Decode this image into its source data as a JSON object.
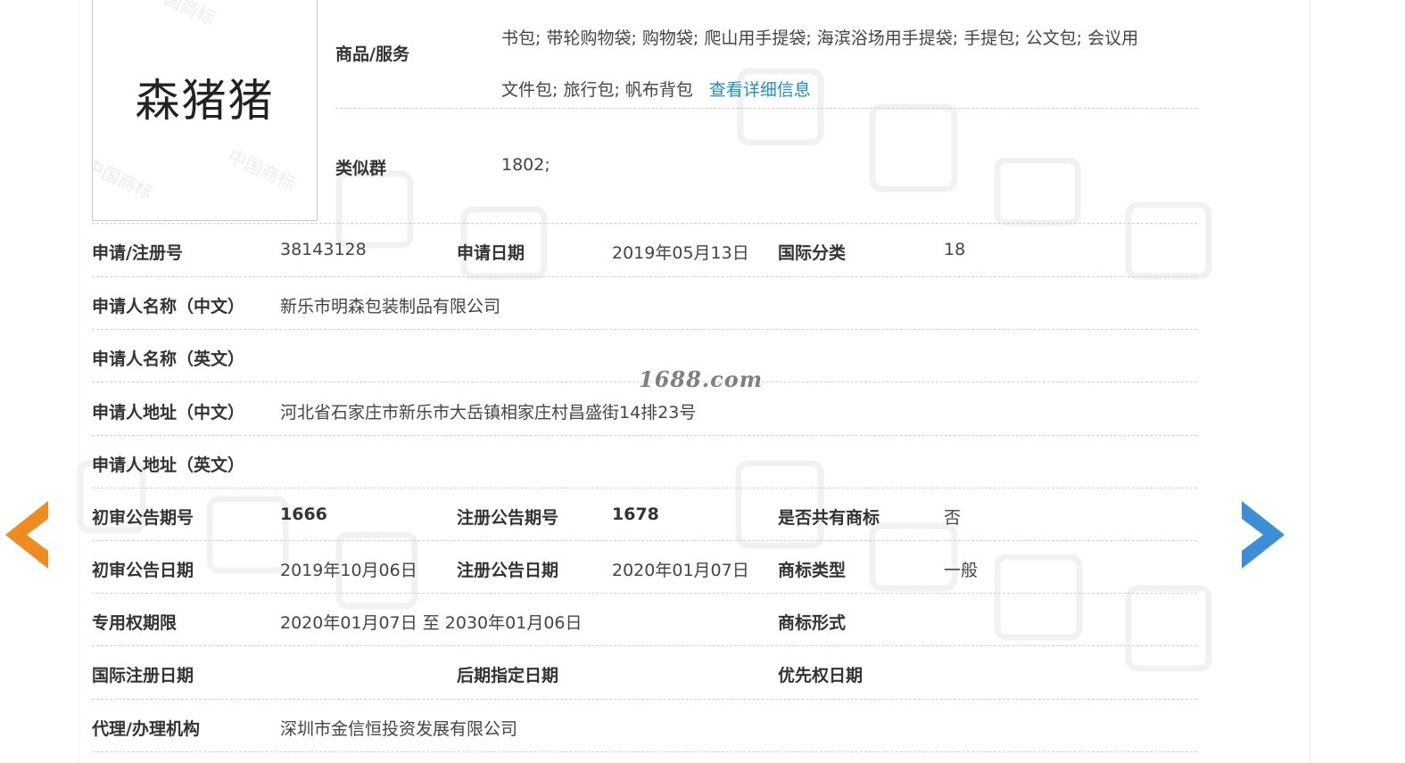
{
  "trademark": {
    "mark_text": "森猪猪",
    "watermark_text": "中国商标"
  },
  "goods": {
    "label": "商品/服务",
    "line1": "书包; 带轮购物袋; 购物袋; 爬山用手提袋; 海滨浴场用手提袋; 手提包; 公文包; 会议用",
    "line2": "文件包; 旅行包; 帆布背包",
    "detail_link": "查看详细信息"
  },
  "similar_group": {
    "label": "类似群",
    "value": "1802;"
  },
  "rows": {
    "reg_no": {
      "label": "申请/注册号",
      "value": "38143128"
    },
    "apply_date": {
      "label": "申请日期",
      "value": "2019年05月13日"
    },
    "intl_class": {
      "label": "国际分类",
      "value": "18"
    },
    "applicant_cn": {
      "label": "申请人名称（中文）",
      "value": "新乐市明森包装制品有限公司"
    },
    "applicant_en": {
      "label": "申请人名称（英文）",
      "value": ""
    },
    "address_cn": {
      "label": "申请人地址（中文）",
      "value": "河北省石家庄市新乐市大岳镇相家庄村昌盛街14排23号"
    },
    "address_en": {
      "label": "申请人地址（英文）",
      "value": ""
    },
    "prelim_issue_no": {
      "label": "初审公告期号",
      "value": "1666"
    },
    "reg_issue_no": {
      "label": "注册公告期号",
      "value": "1678"
    },
    "shared_mark": {
      "label": "是否共有商标",
      "value": "否"
    },
    "prelim_date": {
      "label": "初审公告日期",
      "value": "2019年10月06日"
    },
    "reg_date": {
      "label": "注册公告日期",
      "value": "2020年01月07日"
    },
    "mark_type": {
      "label": "商标类型",
      "value": "一般"
    },
    "exclusive_period": {
      "label": "专用权期限",
      "value": "2020年01月07日 至 2030年01月06日"
    },
    "mark_form": {
      "label": "商标形式",
      "value": ""
    },
    "intl_reg_date": {
      "label": "国际注册日期",
      "value": ""
    },
    "later_designation_date": {
      "label": "后期指定日期",
      "value": ""
    },
    "priority_date": {
      "label": "优先权日期",
      "value": ""
    },
    "agent": {
      "label": "代理/办理机构",
      "value": "深圳市金信恒投资发展有限公司"
    }
  },
  "site_watermark": "1688.com",
  "colors": {
    "link": "#1a8fc9",
    "arrow_left": "#f08c1e",
    "arrow_right": "#3a8fd6",
    "separator": "#cfcfcf"
  },
  "icons": {
    "prev": "arrow-left-icon",
    "next": "arrow-right-icon"
  }
}
